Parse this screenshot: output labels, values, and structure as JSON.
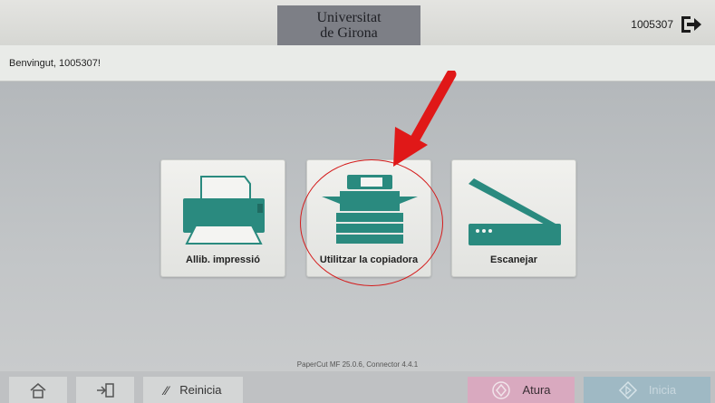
{
  "header": {
    "logo_line1": "Universitat",
    "logo_line2": "de Girona",
    "user_id": "1005307"
  },
  "welcome": {
    "message": "Benvingut, 1005307!"
  },
  "tiles": [
    {
      "label": "Allib. impressió",
      "icon": "printer-icon"
    },
    {
      "label": "Utilitzar la copiadora",
      "icon": "copier-icon"
    },
    {
      "label": "Escanejar",
      "icon": "scanner-icon"
    }
  ],
  "footer": {
    "version": "PaperCut MF 25.0.6, Connector 4.4.1"
  },
  "bottombar": {
    "reset_label": "Reinicia",
    "stop_label": "Atura",
    "start_label": "Inicia"
  },
  "colors": {
    "accent": "#2a8a7f",
    "highlight": "#d41b1b",
    "stop_button": "#d9a9bf",
    "start_button": "#9fb9c4"
  }
}
